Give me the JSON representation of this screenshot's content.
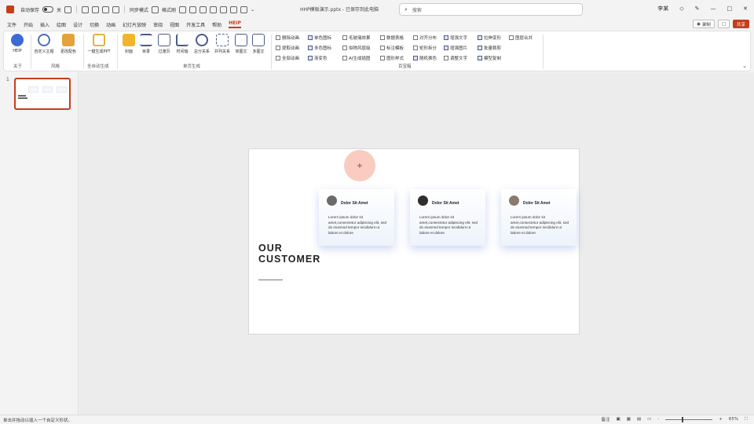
{
  "titlebar": {
    "autosave_label": "自动保存",
    "autosave_state": "关",
    "quick_access": [
      "同步模式",
      "格式刷"
    ],
    "doc_title": "HHP模板演示.pptx - 已保存到此电脑",
    "search_placeholder": "搜索",
    "user_name": "李某"
  },
  "menu": {
    "items": [
      "文件",
      "开始",
      "插入",
      "绘图",
      "设计",
      "切换",
      "动画",
      "幻灯片放映",
      "审阅",
      "视图",
      "开发工具",
      "帮助",
      "HEIP"
    ],
    "active_index": 12
  },
  "right_buttons": {
    "record": "录制",
    "comment": "□",
    "share": "共享"
  },
  "ribbon": {
    "tools": [
      {
        "label": "HEIP",
        "icon": "heip-logo-icon",
        "color": "#3b6ad6"
      },
      {
        "label": "自定义主题",
        "icon": "chat-bubble-icon",
        "color": "#4a6fb5"
      },
      {
        "label": "更改配色",
        "icon": "paint-bucket-icon",
        "color": "#e2a33b"
      },
      {
        "label": "一键生成PPT",
        "icon": "document-star-icon",
        "color": "#e0b43a"
      },
      {
        "label": "封面",
        "icon": "layers-icon",
        "color": "#f0b52a"
      },
      {
        "label": "目录",
        "icon": "list-icon",
        "color": "#4a5a8a"
      },
      {
        "label": "过渡页",
        "icon": "align-icon",
        "color": "#4a5a8a"
      },
      {
        "label": "时间轴",
        "icon": "curve-icon",
        "color": "#4a5a8a"
      },
      {
        "label": "总分关系",
        "icon": "network-icon",
        "color": "#4a5a8a"
      },
      {
        "label": "并列关系",
        "icon": "grid-icon",
        "color": "#4a5a8a"
      },
      {
        "label": "单图文",
        "icon": "image-text-icon",
        "color": "#4a5a8a"
      },
      {
        "label": "多图文",
        "icon": "multi-image-icon",
        "color": "#4a5a8a"
      }
    ],
    "group_labels": [
      "关于",
      "风格",
      "全自动生成",
      "单页生成",
      "百宝箱"
    ],
    "checkboxes": [
      {
        "label": "删除动画",
        "checked": false
      },
      {
        "label": "单色图标",
        "checked": true
      },
      {
        "label": "毛玻璃效果",
        "checked": false
      },
      {
        "label": "数据表格",
        "checked": false
      },
      {
        "label": "对齐分布",
        "checked": false
      },
      {
        "label": "增强文字",
        "checked": true
      },
      {
        "label": "拉伸变形",
        "checked": true
      },
      {
        "label": "图层合并",
        "checked": false
      },
      {
        "label": "提取动画",
        "checked": false
      },
      {
        "label": "多色图标",
        "checked": true
      },
      {
        "label": "拟物风层级",
        "checked": false
      },
      {
        "label": "标注模板",
        "checked": false
      },
      {
        "label": "矩形拆分",
        "checked": false
      },
      {
        "label": "增强图片",
        "checked": true
      },
      {
        "label": "批量裁剪",
        "checked": true
      },
      {
        "label": "全部动画",
        "checked": false
      },
      {
        "label": "渐变色",
        "checked": true
      },
      {
        "label": "AI生成插图",
        "checked": false
      },
      {
        "label": "图形样式",
        "checked": false
      },
      {
        "label": "随机换色",
        "checked": true
      },
      {
        "label": "调整文字",
        "checked": false
      },
      {
        "label": "模型复制",
        "checked": true
      }
    ]
  },
  "slides": {
    "count_label": "1"
  },
  "slide": {
    "heading_line1": "OUR",
    "heading_line2": "CUSTOMER",
    "cards": [
      {
        "title": "Dolor Sit Amet",
        "body": "Lorem ipsum dolor sit amet,consectetur adipiscing elit, sed do eiusmod tempor incididunt ut labore et dolore",
        "avatar": "person-avatar-icon"
      },
      {
        "title": "Dolor Sit Amet",
        "body": "Lorem ipsum dolor sit amet,consectetur adipiscing elit, sed do eiusmod tempor incididunt ut labore et dolore",
        "avatar": "person-avatar-icon"
      },
      {
        "title": "Dolor Sit Amet",
        "body": "Lorem ipsum dolor sit amet,consectetur adipiscing elit, sed do eiusmod tempor incididunt ut labore et dolore",
        "avatar": "person-avatar-icon"
      }
    ],
    "cursor_symbol": "+"
  },
  "statusbar": {
    "left_text": "单击并拖动以插入一个自定义形状。",
    "notes_label": "备注",
    "zoom_minus": "-",
    "zoom_plus": "+",
    "zoom_level": "65%",
    "zoom_fraction": 0.35
  },
  "colors": {
    "accent": "#c43e1c",
    "card_shadow": "#506ec8"
  }
}
